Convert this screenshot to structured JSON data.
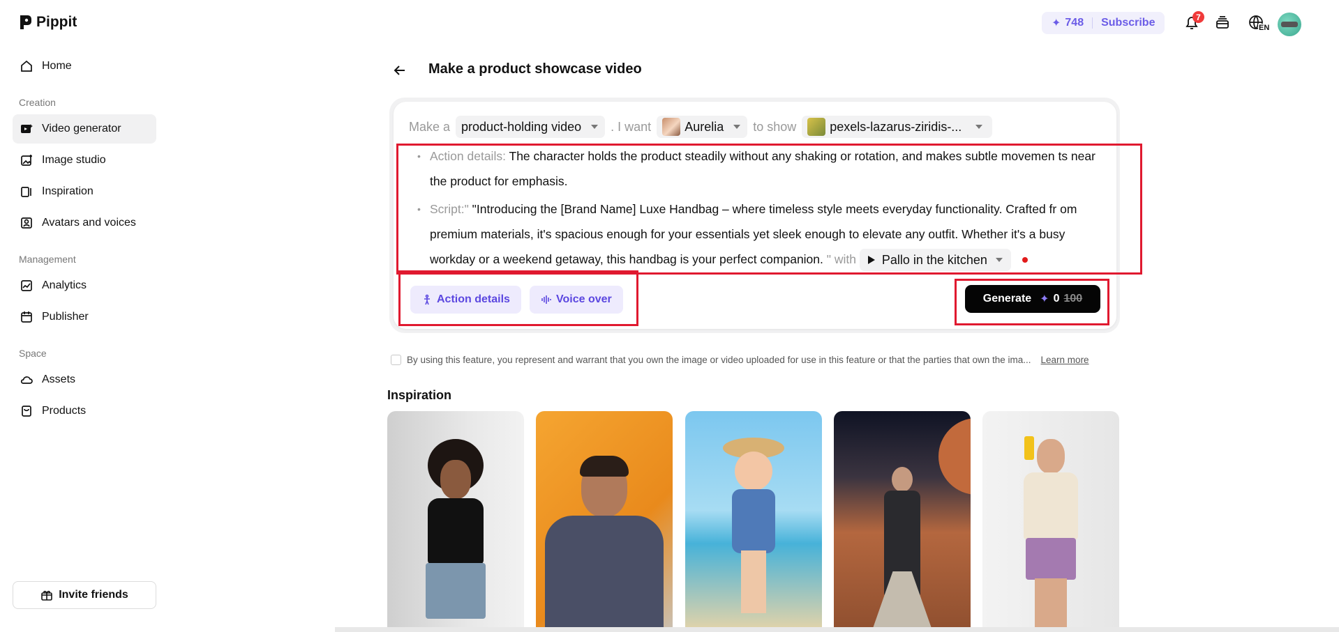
{
  "app": {
    "name": "Pippit"
  },
  "sidebar": {
    "items": [
      {
        "label": "Home",
        "icon": "home-icon"
      },
      {
        "label": "Video generator",
        "icon": "video-generator-icon",
        "active": true
      },
      {
        "label": "Image studio",
        "icon": "image-studio-icon"
      },
      {
        "label": "Inspiration",
        "icon": "inspiration-icon"
      },
      {
        "label": "Avatars and voices",
        "icon": "avatar-voice-icon"
      },
      {
        "label": "Analytics",
        "icon": "analytics-icon"
      },
      {
        "label": "Publisher",
        "icon": "calendar-icon"
      },
      {
        "label": "Assets",
        "icon": "cloud-icon"
      },
      {
        "label": "Products",
        "icon": "product-box-icon"
      }
    ],
    "sections": {
      "creation": "Creation",
      "management": "Management",
      "space": "Space"
    },
    "invite_label": "Invite friends"
  },
  "header": {
    "credits": "748",
    "subscribe_label": "Subscribe",
    "notification_count": "7",
    "language": "EN"
  },
  "page": {
    "title": "Make a product showcase video"
  },
  "prompt": {
    "make_a": "Make a",
    "video_type": "product-holding video",
    "i_want": ". I want",
    "avatar_name": "Aurelia",
    "to_show": "to show",
    "product_name": "pexels-lazarus-ziridis-..."
  },
  "details": {
    "action_label": "Action details:",
    "action_text": " The character holds the product steadily without any shaking or rotation, and makes subtle movemen ts near the product for emphasis.",
    "script_label": "Script:\"",
    "script_text": " \"Introducing the [Brand Name] Luxe Handbag – where timeless style meets everyday functionality. Crafted fr om premium materials, it's spacious enough for your essentials yet sleek enough to elevate any outfit. Whether it's a busy workday or a weekend getaway, this handbag is your perfect companion.",
    "script_close": " \" with",
    "voice_name": "Pallo in the kitchen"
  },
  "actions": {
    "action_details_label": "Action details",
    "voice_over_label": "Voice over",
    "generate_label": "Generate",
    "generate_cost": "0",
    "generate_original_cost": "100"
  },
  "consent": {
    "text": "By using this feature, you represent and warrant that you own the image or video uploaded for use in this feature or that the parties that own the ima...",
    "learn_more": "Learn more"
  },
  "inspiration": {
    "title": "Inspiration",
    "thumbnails": [
      {
        "name": "woman-black-tank-top",
        "bg": "#d9d9d9"
      },
      {
        "name": "man-sitting-orange-wall",
        "bg": "#f0a030"
      },
      {
        "name": "cartoon-girl-beach",
        "bg": "#8fd0f0"
      },
      {
        "name": "man-suit-mars",
        "bg": "#9a5a3a"
      },
      {
        "name": "man-holding-bottle",
        "bg": "#eeeeee"
      }
    ]
  },
  "colors": {
    "accent": "#6b5ce7",
    "highlight_box": "#e0192f",
    "generate_bg": "#050505"
  }
}
